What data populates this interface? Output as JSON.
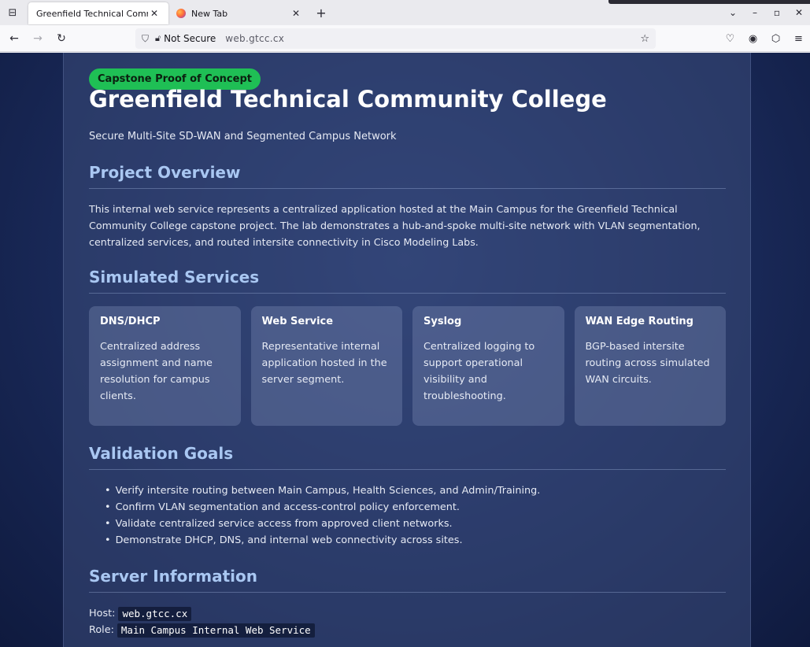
{
  "browser": {
    "tabs": [
      {
        "title": "Greenfield Technical Commu",
        "active": true
      },
      {
        "title": "New Tab",
        "active": false
      }
    ],
    "close_glyph": "✕",
    "new_tab_glyph": "+",
    "url_security_label": "Not Secure",
    "url": "web.gtcc.cx",
    "window_controls": [
      "⌄",
      "–",
      "▫",
      "✕"
    ]
  },
  "page": {
    "badge": "Capstone Proof of Concept",
    "title": "Greenfield Technical Community College",
    "subtitle": "Secure Multi-Site SD-WAN and Segmented Campus Network",
    "overview": {
      "heading": "Project Overview",
      "text": "This internal web service represents a centralized application hosted at the Main Campus for the Greenfield Technical Community College capstone project. The lab demonstrates a hub-and-spoke multi-site network with VLAN segmentation, centralized services, and routed intersite connectivity in Cisco Modeling Labs."
    },
    "services": {
      "heading": "Simulated Services",
      "items": [
        {
          "title": "DNS/DHCP",
          "desc": "Centralized address assignment and name resolution for campus clients."
        },
        {
          "title": "Web Service",
          "desc": "Representative internal application hosted in the server segment."
        },
        {
          "title": "Syslog",
          "desc": "Centralized logging to support operational visibility and troubleshooting."
        },
        {
          "title": "WAN Edge Routing",
          "desc": "BGP-based intersite routing across simulated WAN circuits."
        }
      ]
    },
    "goals": {
      "heading": "Validation Goals",
      "items": [
        "Verify intersite routing between Main Campus, Health Sciences, and Admin/Training.",
        "Confirm VLAN segmentation and access-control policy enforcement.",
        "Validate centralized service access from approved client networks.",
        "Demonstrate DHCP, DNS, and internal web connectivity across sites."
      ]
    },
    "server": {
      "heading": "Server Information",
      "host_label": "Host:",
      "host_value": "web.gtcc.cx",
      "role_label": "Role:",
      "role_value": "Main Campus Internal Web Service"
    }
  },
  "colors": {
    "badge_bg": "#1fbf55",
    "section_heading": "#a9c7f2",
    "background": "#1a2a5a"
  }
}
